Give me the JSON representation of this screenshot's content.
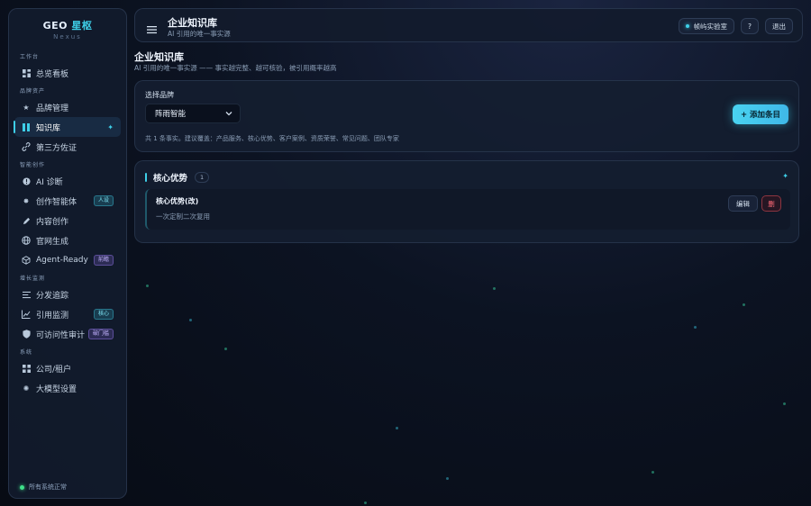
{
  "brand": {
    "title_main": "GEO",
    "title_accent": "星枢",
    "subtitle": "Nexus"
  },
  "sidebar": {
    "sections": [
      {
        "title": "工作台",
        "items": [
          {
            "label": "总览看板",
            "icon": "dashboard-icon"
          }
        ]
      },
      {
        "title": "品牌资产",
        "items": [
          {
            "label": "品牌管理",
            "icon": "star-icon"
          },
          {
            "label": "知识库",
            "icon": "book-icon",
            "active": true
          },
          {
            "label": "第三方佐证",
            "icon": "link-icon"
          }
        ]
      },
      {
        "title": "智能创作",
        "items": [
          {
            "label": "AI 诊断",
            "icon": "alert-icon"
          },
          {
            "label": "创作智能体",
            "icon": "sparkle-icon",
            "badge": "人设"
          },
          {
            "label": "内容创作",
            "icon": "pen-icon"
          },
          {
            "label": "官网生成",
            "icon": "globe-icon"
          },
          {
            "label": "Agent-Ready",
            "icon": "cube-icon",
            "badge": "前瞻"
          }
        ]
      },
      {
        "title": "增长监测",
        "items": [
          {
            "label": "分发追踪",
            "icon": "list-icon"
          },
          {
            "label": "引用监测",
            "icon": "chart-icon",
            "badge": "核心"
          },
          {
            "label": "可访问性审计",
            "icon": "shield-icon",
            "badge": "破门槛"
          }
        ]
      },
      {
        "title": "系统",
        "items": [
          {
            "label": "公司/租户",
            "icon": "grid-icon"
          },
          {
            "label": "大模型设置",
            "icon": "gear-icon"
          }
        ]
      }
    ],
    "status": "所有系统正常"
  },
  "topbar": {
    "title": "企业知识库",
    "subtitle": "AI 引用的唯一事实源",
    "lab_label": "帧屿实验室",
    "help_label": "?",
    "logout_label": "退出"
  },
  "page": {
    "title": "企业知识库",
    "subtitle": "AI 引用的唯一事实源 —— 事实越完整、越可核验，被引用概率越高"
  },
  "brand_picker": {
    "label": "选择品牌",
    "selected": "阵雨智能",
    "hint": "共 1 条事实。建议覆盖：产品服务、核心优势、客户案例、资质荣誉、常见问题、团队专家",
    "add_label": "+ 添加条目"
  },
  "section": {
    "title": "核心优势",
    "count": "1",
    "fact": {
      "title": "核心优势(改)",
      "text": "一次定制二次复用",
      "edit_label": "编辑",
      "delete_label": "删"
    }
  }
}
